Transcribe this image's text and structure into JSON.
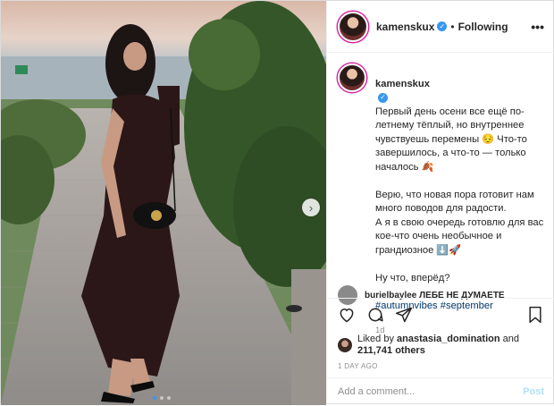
{
  "post": {
    "username": "kamenskux",
    "follow_status": "Following",
    "separator": "•",
    "more_label": "•••"
  },
  "caption": {
    "username": "kamenskux",
    "paragraphs": [
      "Первый день осени все ещё по-летнему тёплый, но внутреннее чувствуешь перемены 😔 Что-то завершилось, а что-то — только началось 🍂",
      "Верю, что новая пора готовит нам много поводов для радости.\nА я в свою очередь готовлю для вас кое-что очень необычное и грандиозное ⬇️🚀",
      "Ну что, вперёд?"
    ],
    "hashtags": "#autumnvibes #september",
    "time": "1d"
  },
  "comment_peek": {
    "text": "burielbaylee ЛЕБЕ НЕ ДУМАЕТЕ"
  },
  "likes": {
    "prefix": "Liked by",
    "user": "anastasia_domination",
    "and": "and",
    "count": "211,741 others"
  },
  "timestamp": "1 DAY AGO",
  "comment_box": {
    "placeholder": "Add a comment...",
    "post_label": "Post"
  },
  "carousel": {
    "next_icon": "›",
    "slides": 3,
    "active": 1
  },
  "colors": {
    "link": "#00376b",
    "accent": "#3897f0",
    "muted": "#8e8e8e"
  }
}
